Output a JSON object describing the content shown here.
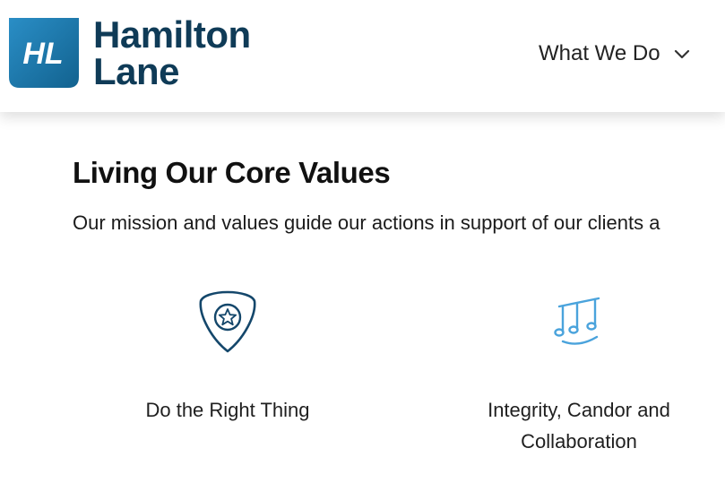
{
  "brand": {
    "mark_text": "HL",
    "name_line1": "Hamilton",
    "name_line2": "Lane",
    "colors": {
      "navy": "#0f3b57",
      "teal_blue": "#1f7fb3",
      "light_blue": "#4aa3dc"
    }
  },
  "nav": {
    "what_we_do_label": "What We Do",
    "icon": "chevron-down-icon"
  },
  "section": {
    "title": "Living Our Core Values",
    "intro": "Our mission and values guide our actions in support of our clients a"
  },
  "values": [
    {
      "icon": "shield-star-icon",
      "label": "Do the Right Thing"
    },
    {
      "icon": "music-notes-icon",
      "label": "Integrity, Candor and Collaboration"
    }
  ]
}
